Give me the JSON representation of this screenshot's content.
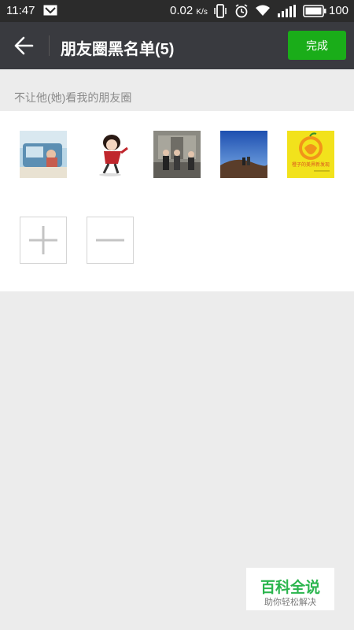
{
  "status_bar": {
    "time": "11:47",
    "speed": "0.02",
    "speed_unit": "K/s",
    "battery": "100"
  },
  "header": {
    "title": "朋友圈黑名单(5)",
    "done_label": "完成"
  },
  "section": {
    "label": "不让他(她)看我的朋友圈"
  },
  "members": [
    {
      "icon": "car-photo"
    },
    {
      "icon": "cartoon-girl"
    },
    {
      "icon": "group-photo"
    },
    {
      "icon": "sky-landscape"
    },
    {
      "icon": "orange-logo",
      "caption": "橙子的美界新发现"
    }
  ],
  "controls": {
    "add_icon": "plus-icon",
    "remove_icon": "minus-icon"
  },
  "watermark": {
    "title": "百科全说",
    "subtitle": "助你轻松解决"
  },
  "colors": {
    "header_bg": "#393a3f",
    "accent": "#1aad19",
    "page_bg": "#ececec"
  }
}
